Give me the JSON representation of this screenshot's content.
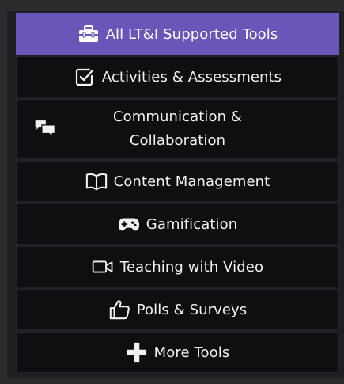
{
  "menu": {
    "items": [
      {
        "label": "All LT&I Supported Tools",
        "icon": "toolbox-icon",
        "active": true
      },
      {
        "label": "Activities & Assessments",
        "icon": "checkbox-icon"
      },
      {
        "label": "Communication & Collaboration",
        "line1": "Communication &",
        "line2": "Collaboration",
        "icon": "chat-bubbles-icon"
      },
      {
        "label": "Content Management",
        "icon": "book-icon"
      },
      {
        "label": "Gamification",
        "icon": "gamepad-icon"
      },
      {
        "label": "Teaching with Video",
        "icon": "video-camera-icon"
      },
      {
        "label": "Polls & Surveys",
        "icon": "thumbs-up-icon"
      },
      {
        "label": "More Tools",
        "icon": "plus-icon"
      }
    ]
  },
  "colors": {
    "active_bg": "#6a55b8",
    "item_bg": "#0f0f12",
    "text": "#f2f2f2"
  }
}
